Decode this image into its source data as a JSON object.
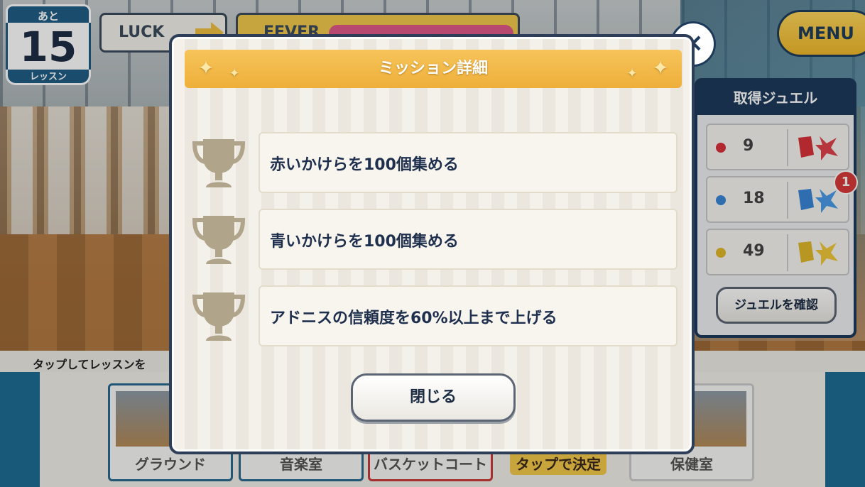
{
  "hud": {
    "lesson_prefix": "あと",
    "lesson_count": "15",
    "lesson_suffix": "レッスン",
    "luck_label": "LUCK",
    "fever_label": "FEVER",
    "menu_label": "MENU"
  },
  "jewels": {
    "title": "取得ジュエル",
    "items": [
      {
        "color": "red",
        "count": "9",
        "hex": "#d8323a"
      },
      {
        "color": "blue",
        "count": "18",
        "hex": "#3a86d8"
      },
      {
        "color": "yellow",
        "count": "49",
        "hex": "#e0b82a"
      }
    ],
    "notification": "1",
    "check_button": "ジュエルを確認"
  },
  "bottom": {
    "tip": "タップしてレッスンを",
    "locations": [
      "グラウンド",
      "音楽室",
      "バスケットコート",
      "保健室"
    ],
    "tap_decide": "タップで決定"
  },
  "modal": {
    "title": "ミッション詳細",
    "missions": [
      {
        "text": "赤いかけらを100個集める"
      },
      {
        "text": "青いかけらを100個集める"
      },
      {
        "text": "アドニスの信頼度を60%以上まで上げる"
      }
    ],
    "close_button": "閉じる",
    "close_icon": "×"
  },
  "colors": {
    "accent_gold": "#f0b93a",
    "navy": "#1d3a5c",
    "trophy": "#b0a48a"
  }
}
